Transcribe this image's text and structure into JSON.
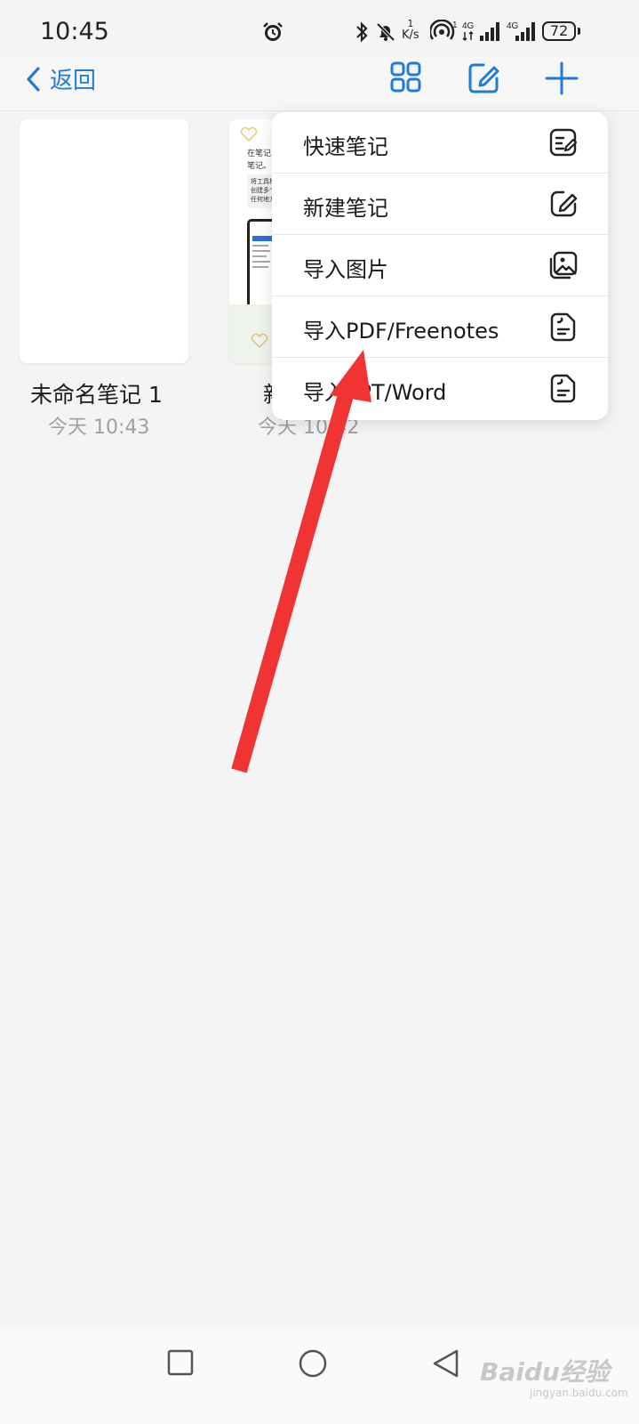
{
  "status_bar": {
    "time": "10:45",
    "net_speed_value": "1",
    "net_speed_unit": "K/s",
    "signal1_label": "4G",
    "signal2_label": "4G",
    "battery": "72",
    "icons": [
      "alarm-icon",
      "bluetooth-icon",
      "mute-icon",
      "hotspot-icon",
      "signal-icon",
      "signal-icon",
      "battery-icon"
    ]
  },
  "titlebar": {
    "back_label": "返回",
    "icons": [
      "chevron-left-icon",
      "grid-view-icon",
      "edit-icon",
      "plus-icon"
    ],
    "accent_color": "#1f7bd6"
  },
  "notes": [
    {
      "title": "未命名笔记 1",
      "date": "今天 10:43"
    },
    {
      "title": "新",
      "date": "今天 10:42"
    }
  ],
  "note2_preview": {
    "line1": "在笔记·",
    "line2": "笔记。",
    "line3": "将工具栏",
    "line4": "创建多个",
    "line5": "任何地方"
  },
  "menu": {
    "items": [
      {
        "label": "快速笔记",
        "icon": "quick-note-icon"
      },
      {
        "label": "新建笔记",
        "icon": "edit-note-icon"
      },
      {
        "label": "导入图片",
        "icon": "image-icon"
      },
      {
        "label": "导入PDF/Freenotes",
        "icon": "document-icon"
      },
      {
        "label": "导入PPT/Word",
        "icon": "document-icon"
      }
    ]
  },
  "annotation": {
    "arrow_color": "#f03434"
  },
  "navbar": {
    "icons": [
      "recents-square-icon",
      "home-circle-icon",
      "back-triangle-icon"
    ]
  },
  "watermark": {
    "text": "Baidu经验",
    "sub": "jingyan.baidu.com"
  }
}
